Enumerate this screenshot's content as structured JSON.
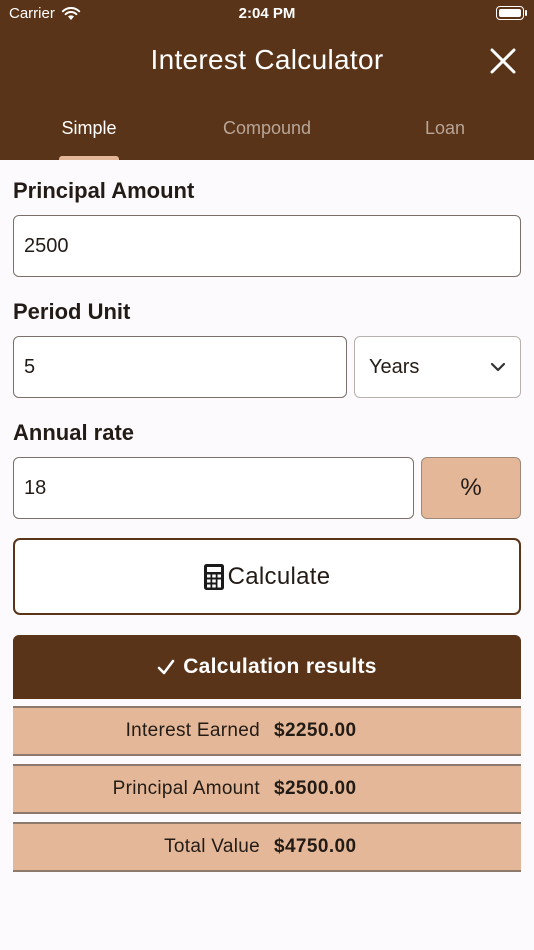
{
  "status_bar": {
    "carrier": "Carrier",
    "time": "2:04 PM"
  },
  "header": {
    "title": "Interest Calculator"
  },
  "tabs": [
    {
      "label": "Simple",
      "active": true
    },
    {
      "label": "Compound",
      "active": false
    },
    {
      "label": "Loan",
      "active": false
    }
  ],
  "form": {
    "principal": {
      "label": "Principal Amount",
      "value": "2500"
    },
    "period": {
      "label": "Period Unit",
      "value": "5",
      "unit": "Years"
    },
    "rate": {
      "label": "Annual rate",
      "value": "18",
      "unit_button": "%"
    }
  },
  "calculate_button": {
    "label": "Calculate"
  },
  "results": {
    "title": "Calculation results",
    "rows": [
      {
        "label": "Interest Earned",
        "value": "$2250.00"
      },
      {
        "label": "Principal Amount",
        "value": "$2500.00"
      },
      {
        "label": "Total Value",
        "value": "$4750.00"
      }
    ]
  },
  "colors": {
    "header_bg": "#5a3418",
    "accent": "#e3b797",
    "page_bg": "#fcfafc"
  }
}
